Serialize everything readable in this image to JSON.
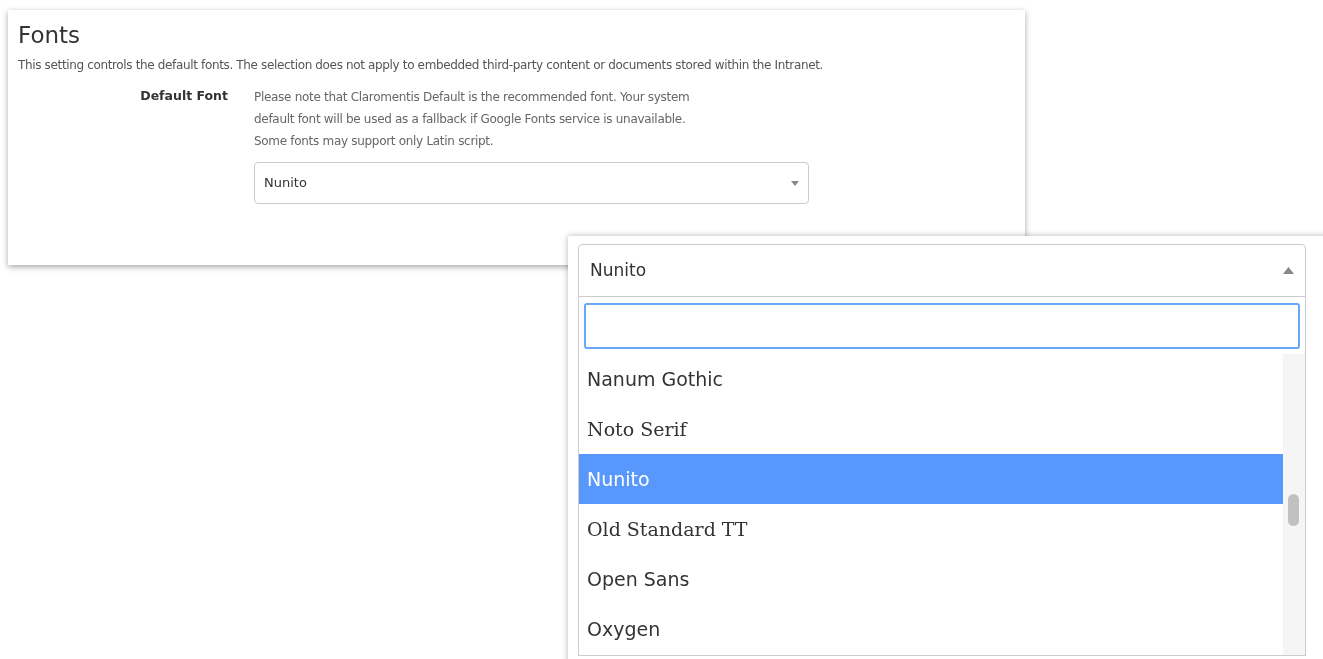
{
  "section": {
    "title": "Fonts",
    "description": "This setting controls the default fonts. The selection does not apply to embedded third-party content or documents stored within the Intranet.",
    "field": {
      "label": "Default Font",
      "help": [
        "Please note that Claromentis Default is the recommended font. Your system",
        "default font will be used as a fallback if Google Fonts service is unavailable.",
        "Some fonts may support only Latin script."
      ],
      "value": "Nunito"
    }
  },
  "dropdown": {
    "value": "Nunito",
    "expanded": true,
    "options": [
      {
        "label": "Nanum Gothic",
        "kind": "sans",
        "selected": false
      },
      {
        "label": "Noto Serif",
        "kind": "serif",
        "selected": false
      },
      {
        "label": "Nunito",
        "kind": "sans",
        "selected": true
      },
      {
        "label": "Old Standard TT",
        "kind": "serif",
        "selected": false
      },
      {
        "label": "Open Sans",
        "kind": "sans",
        "selected": false
      },
      {
        "label": "Oxygen",
        "kind": "sans",
        "selected": false
      }
    ]
  }
}
